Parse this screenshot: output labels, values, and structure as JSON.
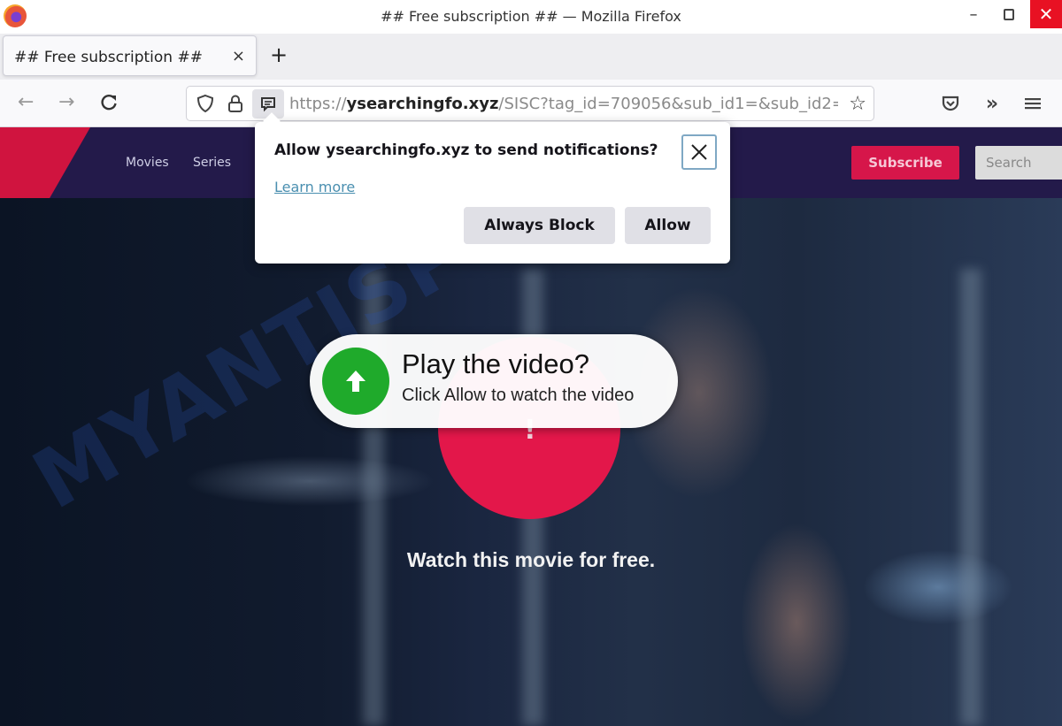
{
  "window": {
    "title": "## Free subscription ## — Mozilla Firefox",
    "minimize": "–",
    "close": "✕"
  },
  "tabs": [
    {
      "label": "## Free subscription ##",
      "close": "×",
      "active": true
    }
  ],
  "new_tab": "+",
  "nav": {
    "back": "←",
    "forward": "→",
    "reload": "↻",
    "url_prefix": "https://",
    "url_domain": "ysearchingfo.xyz",
    "url_path": "/SISC?tag_id=709056&sub_id1=&sub_id2=",
    "bookmark_star": "☆",
    "overflow": "»"
  },
  "site": {
    "nav_items": [
      "Movies",
      "Series"
    ],
    "subscribe_label": "Subscribe",
    "search_placeholder": "Search",
    "exclamation": "!",
    "watch_text": "Watch this movie for free.",
    "watermark": "MYANTISPYWARE.COM",
    "colors": {
      "header": "#231a4a",
      "accent": "#d6164a",
      "play_green": "#1faa2b"
    }
  },
  "play_prompt": {
    "title": "Play the video?",
    "subtitle": "Click Allow to watch the video"
  },
  "permission_popup": {
    "title": "Allow ysearchingfo.xyz to send notifications?",
    "learn_more": "Learn more",
    "block_label": "Always Block",
    "allow_label": "Allow"
  }
}
